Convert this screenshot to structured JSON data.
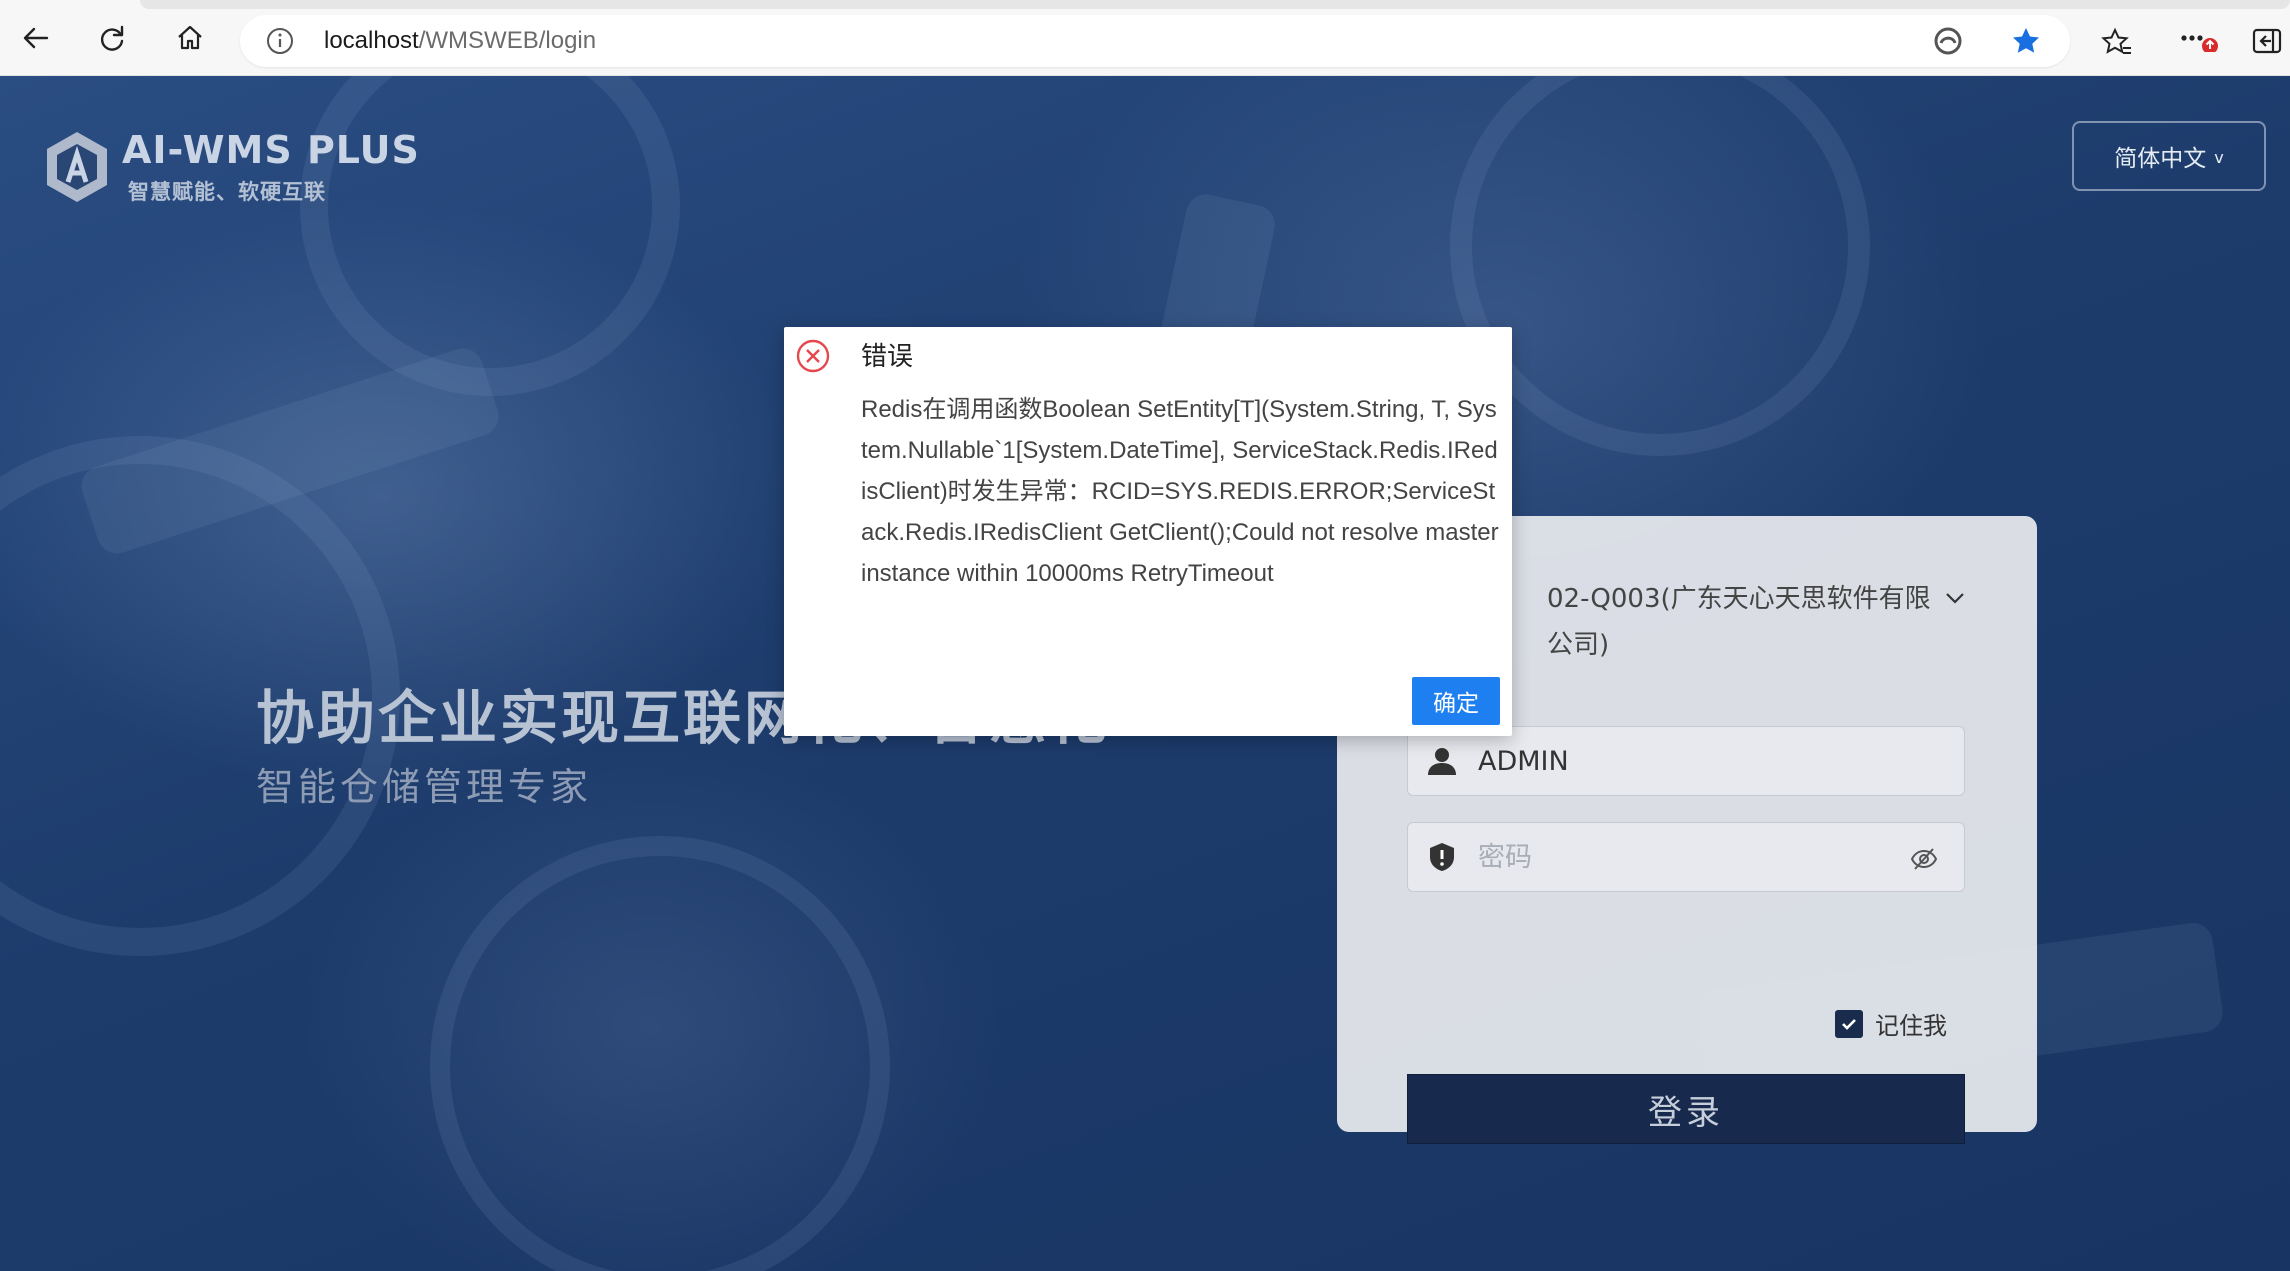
{
  "browser": {
    "url_host": "localhost",
    "url_path": "/WMSWEB/login"
  },
  "page": {
    "logo": {
      "title": "AI-WMS  PLUS",
      "subtitle": "智慧赋能、软硬互联"
    },
    "language": {
      "selected": "简体中文",
      "chevron": "v"
    },
    "slogan": {
      "main": "协助企业实现互联网化、智慧化",
      "sub": "智能仓储管理专家"
    }
  },
  "login": {
    "tenant": "02-Q003(广东天心天思软件有限公司)",
    "username": "ADMIN",
    "password_placeholder": "密码",
    "remember_label": "记住我",
    "remember_checked": true,
    "submit_label": "登录"
  },
  "dialog": {
    "title": "错误",
    "message": "Redis在调用函数Boolean SetEntity[T](System.String, T, System.Nullable`1[System.DateTime], ServiceStack.Redis.IRedisClient)时发生异常：RCID=SYS.REDIS.ERROR;ServiceStack.Redis.IRedisClient GetClient();Could not resolve master instance within 10000ms RetryTimeout",
    "ok_label": "确定"
  },
  "colors": {
    "accent": "#1e7ff0",
    "error": "#e5484d",
    "login_button": "#172a4d",
    "star": "#1a6fe0"
  }
}
